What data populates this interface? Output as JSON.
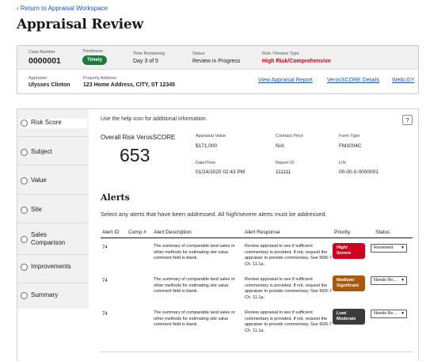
{
  "nav": {
    "back_link": "‹ Return to Appraisal Workspace"
  },
  "page": {
    "title": "Appraisal Review"
  },
  "summary": {
    "case_number": {
      "label": "Case Number",
      "value": "0000001"
    },
    "timeliness": {
      "label": "Timeliness",
      "value": "Timely"
    },
    "time_remaining": {
      "label": "Time Remaining",
      "value": "Day 3 of 5"
    },
    "status": {
      "label": "Status",
      "value": "Review in Progress"
    },
    "risk_type": {
      "label": "Risk / Review Type",
      "value": "High Risk/Comprehensive"
    },
    "appraiser": {
      "label": "Appraiser",
      "value": "Ulysses Clinton"
    },
    "property": {
      "label": "Property Address",
      "value": "123 Home Address, CITY, ST 12345"
    },
    "links": [
      "View Appraisal Report",
      "VerosSCORE Details",
      "WebLGY"
    ]
  },
  "sidebar": {
    "items": [
      {
        "label": "Risk Score"
      },
      {
        "label": "Subject"
      },
      {
        "label": "Value"
      },
      {
        "label": "Site"
      },
      {
        "label": "Sales Comparison"
      },
      {
        "label": "Improvements"
      },
      {
        "label": "Summary"
      }
    ]
  },
  "content": {
    "help_text": "Use the help icon for additional information.",
    "help_button": "?",
    "score_label": "Overall Risk VerosSCORE",
    "score_value": "653",
    "details": {
      "appraisal_value": {
        "label": "Appraisal Value",
        "value": "$171,000"
      },
      "contract_price": {
        "label": "Contract Price",
        "value": "N/A"
      },
      "form_type": {
        "label": "Form Type",
        "value": "FM1004C"
      },
      "date_time": {
        "label": "Date/Time",
        "value": "01/24/2020 02:43 PM"
      },
      "report_id": {
        "label": "Report ID",
        "value": "111111"
      },
      "lin": {
        "label": "LIN",
        "value": "00-00-0-0000001"
      }
    }
  },
  "alerts": {
    "title": "Alerts",
    "instruction": "Select any alerts that have been addressed. All high/severe alerts must be addressed.",
    "columns": [
      "Alert ID",
      "Comp #",
      "Alert Description",
      "Alert Response",
      "Priority",
      "Status"
    ],
    "rows": [
      {
        "id": "74",
        "description": "The summary of comparable land sales or other methods for estimating site value comment field is blank.",
        "response": "Review appraisal to see if sufficient commentary is provided. If not, request the appraiser to provide commentary. See M26-7 Ch. 11.1a.",
        "priority": "High/ Severe",
        "priority_color": "#d0021b",
        "status": "Reviewed"
      },
      {
        "id": "74",
        "description": "The summary of comparable land sales or other methods for estimating site value comment field is blank.",
        "response": "Review appraisal to see if sufficient commentary is provided. If not, request the appraiser to provide commentary. See M26-7 Ch. 11.1a.",
        "priority": "Medium/ Significant",
        "priority_color": "#a9580c",
        "status": "Needs Re..."
      },
      {
        "id": "74",
        "description": "The summary of comparable land sales or other methods for estimating site value comment field is blank.",
        "response": "Review appraisal to see if sufficient commentary is provided. If not, request the appraiser to provide commentary. See M26-7 Ch. 11.1a.",
        "priority": "Low/ Moderate",
        "priority_color": "#3c3c3c",
        "status": "Needs Re..."
      }
    ]
  }
}
